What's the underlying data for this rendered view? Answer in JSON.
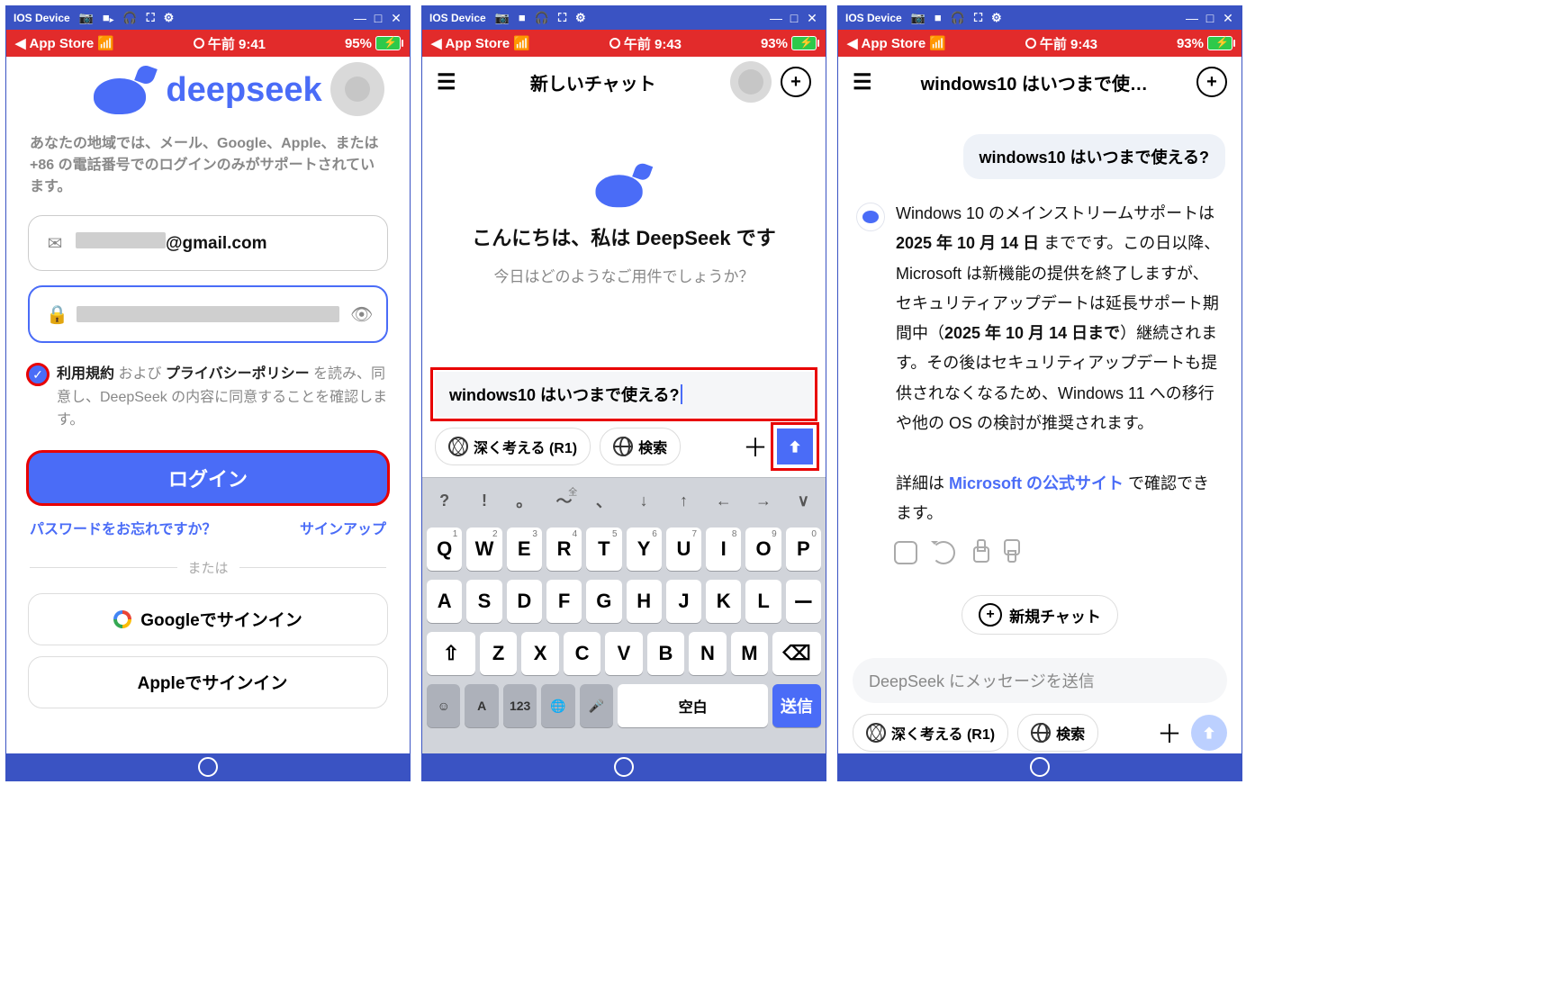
{
  "emu": {
    "label": "IOS Device"
  },
  "status": {
    "back": "App Store",
    "time1": "午前 9:41",
    "batt1": "95%",
    "time2": "午前 9:43",
    "batt2": "93%",
    "time3": "午前 9:43",
    "batt3": "93%"
  },
  "screen1": {
    "logo_text": "deepseek",
    "region_note": "あなたの地域では、メール、Google、Apple、または +86 の電話番号でのログインのみがサポートされています。",
    "email_suffix": "@gmail.com",
    "terms": {
      "tos": "利用規約",
      "and": " および ",
      "pp": "プライバシーポリシー",
      "tail": " を読み、同意し、DeepSeek の内容に同意することを確認します。"
    },
    "login": "ログイン",
    "forgot": "パスワードをお忘れですか？",
    "signup": "サインアップ",
    "or": "または",
    "google": "Googleでサインイン",
    "apple": "Appleでサインイン"
  },
  "screen2": {
    "title": "新しいチャット",
    "greeting": "こんにちは、私は DeepSeek です",
    "sub": "今日はどのようなご用件でしょうか？",
    "prompt": "windows10 はいつまで使える?",
    "chip_think": "深く考える (R1)",
    "chip_search": "検索",
    "kb": {
      "top": [
        "?",
        "!",
        "。",
        "〜",
        "、",
        "↓",
        "↑",
        "←",
        "→",
        "∨"
      ],
      "top_anno": "全",
      "row1": [
        "Q",
        "W",
        "E",
        "R",
        "T",
        "Y",
        "U",
        "I",
        "O",
        "P"
      ],
      "row1_sup": [
        "1",
        "2",
        "3",
        "4",
        "5",
        "6",
        "7",
        "8",
        "9",
        "0"
      ],
      "row2": [
        "A",
        "S",
        "D",
        "F",
        "G",
        "H",
        "J",
        "K",
        "L",
        "ー"
      ],
      "row3_shift": "⇧",
      "row3": [
        "Z",
        "X",
        "C",
        "V",
        "B",
        "N",
        "M"
      ],
      "row3_del": "⌫",
      "fn_emoji": "☺",
      "fn_a": "A",
      "fn_123": "123",
      "fn_globe": "🌐",
      "fn_mic": "🎤",
      "space": "空白",
      "send": "送信"
    }
  },
  "screen3": {
    "title": "windows10 はいつまで使…",
    "user_msg": "windows10 はいつまで使える?",
    "answer_p1a": "Windows 10 のメインストリームサポートは ",
    "answer_p1b": "2025 年 10 月 14 日",
    "answer_p1c": " までです。この日以降、Microsoft は新機能の提供を終了しますが、セキュリティアップデートは延長サポート期間中（",
    "answer_p1d": "2025 年 10 月 14 日まで",
    "answer_p1e": "）継続されます。その後はセキュリティアップデートも提供されなくなるため、Windows 11 への移行や他の OS の検討が推奨されます。",
    "answer_p2a": "詳細は ",
    "answer_link": "Microsoft の公式サイト",
    "answer_p2b": " で確認できます。",
    "new_chat": "新規チャット",
    "placeholder": "DeepSeek にメッセージを送信",
    "chip_think": "深く考える (R1)",
    "chip_search": "検索"
  }
}
